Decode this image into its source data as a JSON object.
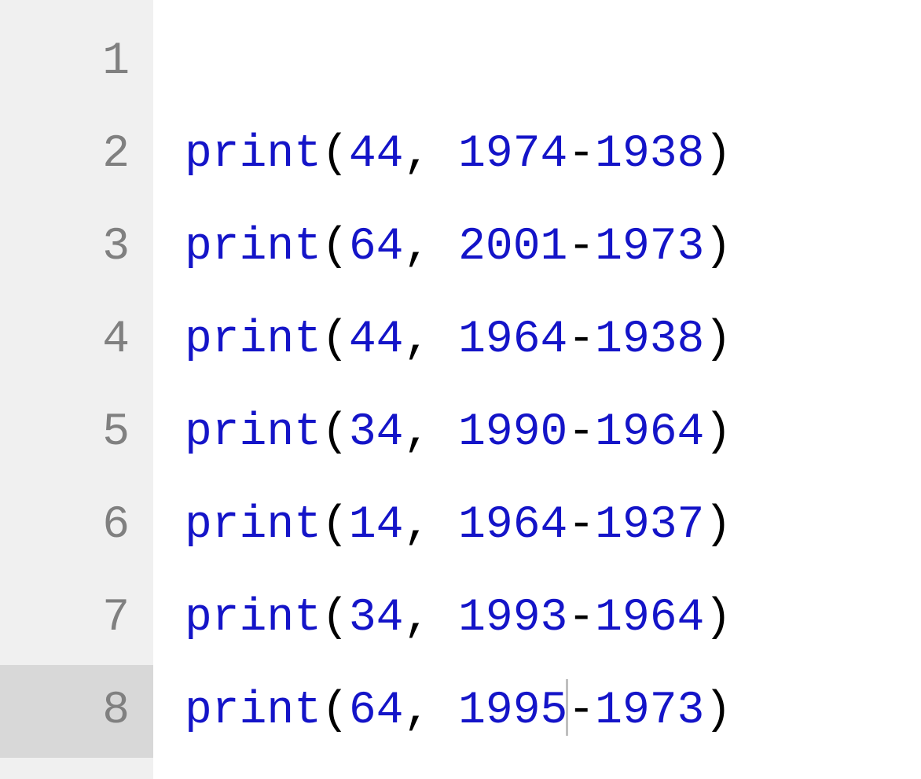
{
  "editor": {
    "current_line": 8,
    "cursor": {
      "line": 8,
      "after_token_index": 6
    },
    "lines": [
      {
        "num": "1",
        "tokens": []
      },
      {
        "num": "2",
        "tokens": [
          {
            "t": "func",
            "v": "print"
          },
          {
            "t": "punc",
            "v": "("
          },
          {
            "t": "num",
            "v": "44"
          },
          {
            "t": "punc",
            "v": ", "
          },
          {
            "t": "num",
            "v": "1974"
          },
          {
            "t": "punc",
            "v": "-"
          },
          {
            "t": "num",
            "v": "1938"
          },
          {
            "t": "punc",
            "v": ")"
          }
        ]
      },
      {
        "num": "3",
        "tokens": [
          {
            "t": "func",
            "v": "print"
          },
          {
            "t": "punc",
            "v": "("
          },
          {
            "t": "num",
            "v": "64"
          },
          {
            "t": "punc",
            "v": ", "
          },
          {
            "t": "num",
            "v": "2001"
          },
          {
            "t": "punc",
            "v": "-"
          },
          {
            "t": "num",
            "v": "1973"
          },
          {
            "t": "punc",
            "v": ")"
          }
        ]
      },
      {
        "num": "4",
        "tokens": [
          {
            "t": "func",
            "v": "print"
          },
          {
            "t": "punc",
            "v": "("
          },
          {
            "t": "num",
            "v": "44"
          },
          {
            "t": "punc",
            "v": ", "
          },
          {
            "t": "num",
            "v": "1964"
          },
          {
            "t": "punc",
            "v": "-"
          },
          {
            "t": "num",
            "v": "1938"
          },
          {
            "t": "punc",
            "v": ")"
          }
        ]
      },
      {
        "num": "5",
        "tokens": [
          {
            "t": "func",
            "v": "print"
          },
          {
            "t": "punc",
            "v": "("
          },
          {
            "t": "num",
            "v": "34"
          },
          {
            "t": "punc",
            "v": ", "
          },
          {
            "t": "num",
            "v": "1990"
          },
          {
            "t": "punc",
            "v": "-"
          },
          {
            "t": "num",
            "v": "1964"
          },
          {
            "t": "punc",
            "v": ")"
          }
        ]
      },
      {
        "num": "6",
        "tokens": [
          {
            "t": "func",
            "v": "print"
          },
          {
            "t": "punc",
            "v": "("
          },
          {
            "t": "num",
            "v": "14"
          },
          {
            "t": "punc",
            "v": ", "
          },
          {
            "t": "num",
            "v": "1964"
          },
          {
            "t": "punc",
            "v": "-"
          },
          {
            "t": "num",
            "v": "1937"
          },
          {
            "t": "punc",
            "v": ")"
          }
        ]
      },
      {
        "num": "7",
        "tokens": [
          {
            "t": "func",
            "v": "print"
          },
          {
            "t": "punc",
            "v": "("
          },
          {
            "t": "num",
            "v": "34"
          },
          {
            "t": "punc",
            "v": ", "
          },
          {
            "t": "num",
            "v": "1993"
          },
          {
            "t": "punc",
            "v": "-"
          },
          {
            "t": "num",
            "v": "1964"
          },
          {
            "t": "punc",
            "v": ")"
          }
        ]
      },
      {
        "num": "8",
        "tokens": [
          {
            "t": "func",
            "v": "print"
          },
          {
            "t": "punc",
            "v": "("
          },
          {
            "t": "num",
            "v": "64"
          },
          {
            "t": "punc",
            "v": ", "
          },
          {
            "t": "num",
            "v": "1995"
          },
          {
            "t": "punc",
            "v": "-"
          },
          {
            "t": "num",
            "v": "1973"
          },
          {
            "t": "punc",
            "v": ")"
          }
        ]
      }
    ]
  }
}
